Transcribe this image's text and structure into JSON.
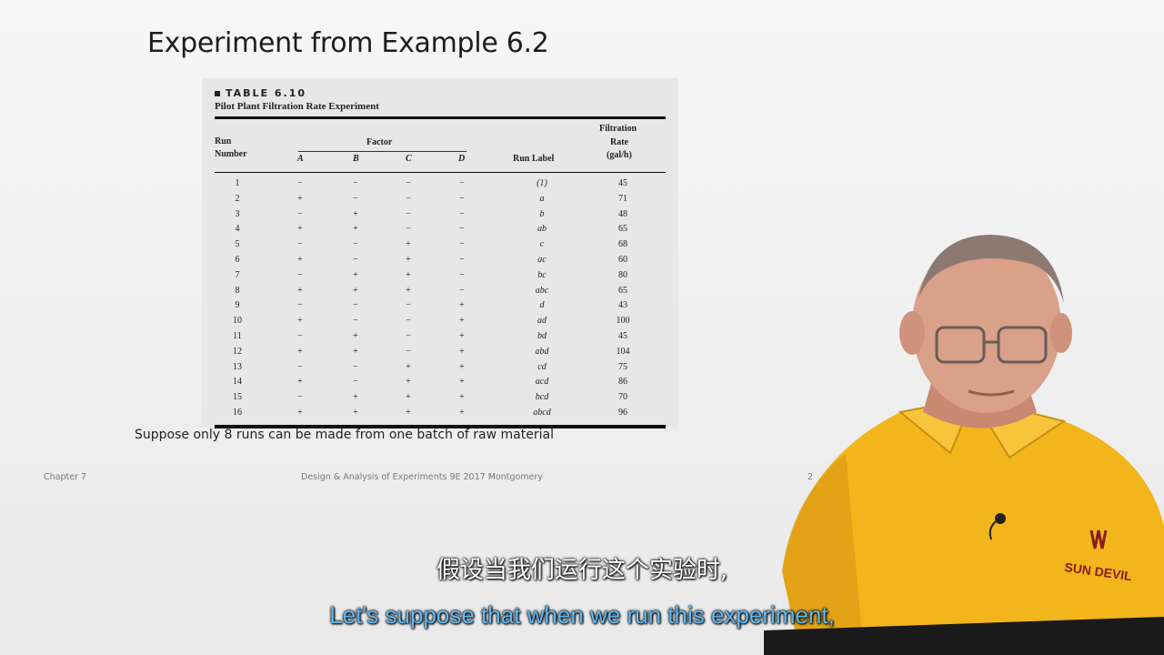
{
  "slide": {
    "title": "Experiment from Example 6.2",
    "table_label": "TABLE 6.10",
    "table_caption": "Pilot Plant Filtration Rate Experiment",
    "headers": {
      "run_top": "Run",
      "run_bottom": "Number",
      "factor": "Factor",
      "a": "A",
      "b": "B",
      "c": "C",
      "d": "D",
      "run_label": "Run Label",
      "rate_1": "Filtration",
      "rate_2": "Rate",
      "rate_3": "(gal/h)"
    },
    "rows": [
      {
        "run": "1",
        "a": "−",
        "b": "−",
        "c": "−",
        "d": "−",
        "label": "(1)",
        "rate": "45"
      },
      {
        "run": "2",
        "a": "+",
        "b": "−",
        "c": "−",
        "d": "−",
        "label": "a",
        "rate": "71"
      },
      {
        "run": "3",
        "a": "−",
        "b": "+",
        "c": "−",
        "d": "−",
        "label": "b",
        "rate": "48"
      },
      {
        "run": "4",
        "a": "+",
        "b": "+",
        "c": "−",
        "d": "−",
        "label": "ab",
        "rate": "65"
      },
      {
        "run": "5",
        "a": "−",
        "b": "−",
        "c": "+",
        "d": "−",
        "label": "c",
        "rate": "68"
      },
      {
        "run": "6",
        "a": "+",
        "b": "−",
        "c": "+",
        "d": "−",
        "label": "ac",
        "rate": "60"
      },
      {
        "run": "7",
        "a": "−",
        "b": "+",
        "c": "+",
        "d": "−",
        "label": "bc",
        "rate": "80"
      },
      {
        "run": "8",
        "a": "+",
        "b": "+",
        "c": "+",
        "d": "−",
        "label": "abc",
        "rate": "65"
      },
      {
        "run": "9",
        "a": "−",
        "b": "−",
        "c": "−",
        "d": "+",
        "label": "d",
        "rate": "43"
      },
      {
        "run": "10",
        "a": "+",
        "b": "−",
        "c": "−",
        "d": "+",
        "label": "ad",
        "rate": "100"
      },
      {
        "run": "11",
        "a": "−",
        "b": "+",
        "c": "−",
        "d": "+",
        "label": "bd",
        "rate": "45"
      },
      {
        "run": "12",
        "a": "+",
        "b": "+",
        "c": "−",
        "d": "+",
        "label": "abd",
        "rate": "104"
      },
      {
        "run": "13",
        "a": "−",
        "b": "−",
        "c": "+",
        "d": "+",
        "label": "cd",
        "rate": "75"
      },
      {
        "run": "14",
        "a": "+",
        "b": "−",
        "c": "+",
        "d": "+",
        "label": "acd",
        "rate": "86"
      },
      {
        "run": "15",
        "a": "−",
        "b": "+",
        "c": "+",
        "d": "+",
        "label": "bcd",
        "rate": "70"
      },
      {
        "run": "16",
        "a": "+",
        "b": "+",
        "c": "+",
        "d": "+",
        "label": "abcd",
        "rate": "96"
      }
    ],
    "note": "Suppose only 8 runs can be made from one batch of raw material",
    "footer": {
      "chapter": "Chapter 7",
      "center": "Design & Analysis of Experiments 9E 2017 Montgomery",
      "page": "2"
    }
  },
  "speaker": {
    "shirt_logo": "SUN DEVIL",
    "colors": {
      "shirt": "#f2b51c",
      "skin": "#d9a08a",
      "hair": "#8c7a70"
    }
  },
  "subtitles": {
    "zh": "假设当我们运行这个实验时,",
    "en": "Let's suppose that when we run this experiment,"
  }
}
